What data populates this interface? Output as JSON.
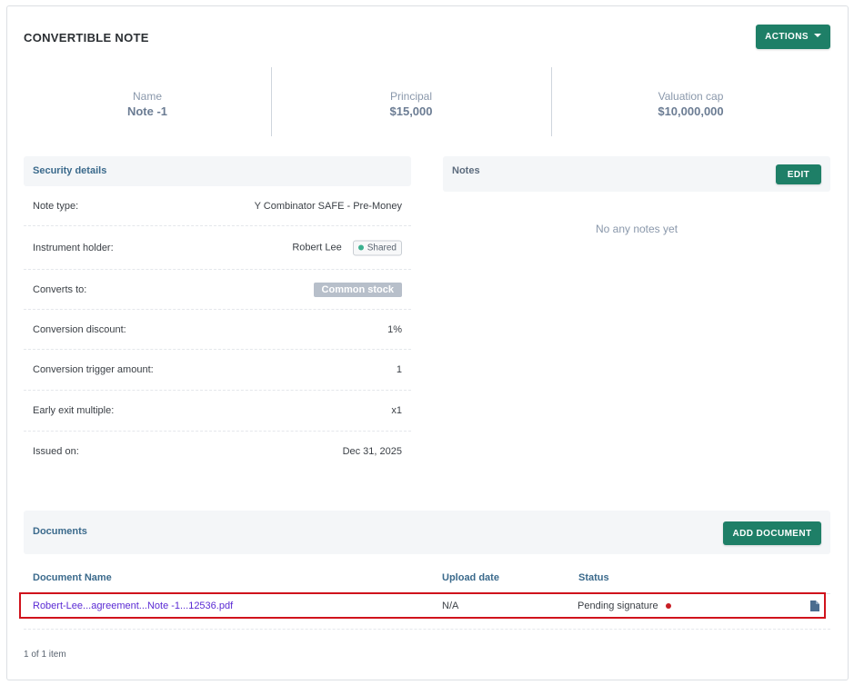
{
  "header": {
    "title": "CONVERTIBLE NOTE",
    "actions_label": "ACTIONS"
  },
  "summary": [
    {
      "label": "Name",
      "value": "Note -1"
    },
    {
      "label": "Principal",
      "value": "$15,000"
    },
    {
      "label": "Valuation cap",
      "value": "$10,000,000"
    }
  ],
  "security_details": {
    "title": "Security details",
    "rows": [
      {
        "key": "Note type:",
        "value": "Y Combinator SAFE - Pre-Money"
      },
      {
        "key": "Instrument holder:",
        "value": "Robert Lee",
        "badge": "Shared"
      },
      {
        "key": "Converts to:",
        "value": "Common stock"
      },
      {
        "key": "Conversion discount:",
        "value": "1%"
      },
      {
        "key": "Conversion trigger amount:",
        "value": "1"
      },
      {
        "key": "Early exit multiple:",
        "value": "x1"
      },
      {
        "key": "Issued on:",
        "value": "Dec 31, 2025"
      }
    ]
  },
  "notes": {
    "title": "Notes",
    "edit_label": "EDIT",
    "empty_text": "No any notes yet"
  },
  "documents": {
    "title": "Documents",
    "add_label": "ADD DOCUMENT",
    "columns": [
      "Document Name",
      "Upload date",
      "Status"
    ],
    "rows": [
      {
        "name": "Robert-Lee...agreement...Note -1...12536.pdf",
        "upload_date": "N/A",
        "status": "Pending signature",
        "icon": "document-icon"
      }
    ]
  },
  "pagination": {
    "text": "1 of 1 item"
  },
  "colors": {
    "primary_button": "#1e7f67",
    "heading_blue": "#3b6a8c",
    "link_purple": "#5a2ad4",
    "status_red": "#c81e25",
    "highlight_border": "#d0131c"
  }
}
